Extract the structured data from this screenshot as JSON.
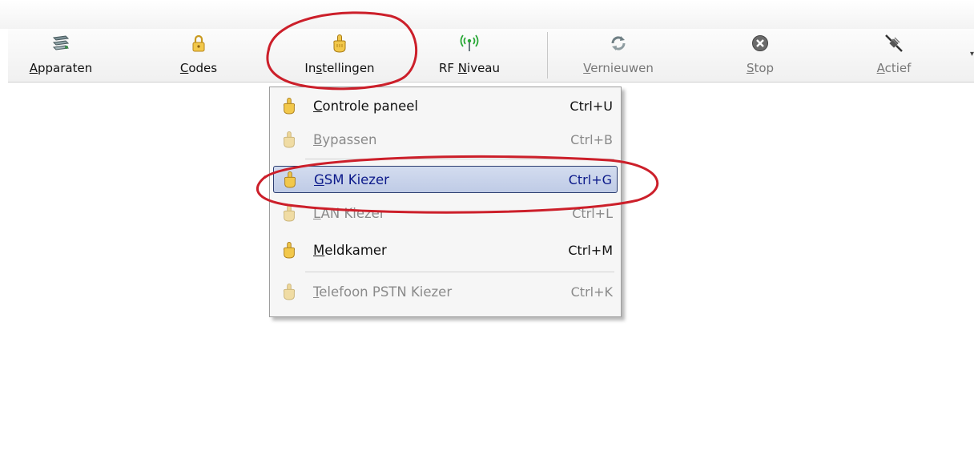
{
  "toolbar": {
    "buttons": [
      {
        "pre": "",
        "mnemonic": "A",
        "post": "pparaten",
        "icon": "devices-icon",
        "disabled": false
      },
      {
        "pre": "",
        "mnemonic": "C",
        "post": "odes",
        "icon": "padlock-icon",
        "disabled": false
      },
      {
        "pre": "In",
        "mnemonic": "s",
        "post": "tellingen",
        "icon": "settings-hand-icon",
        "disabled": false
      },
      {
        "pre": "RF ",
        "mnemonic": "N",
        "post": "iveau",
        "icon": "rf-antenna-icon",
        "disabled": false
      },
      {
        "pre": "",
        "mnemonic": "V",
        "post": "ernieuwen",
        "icon": "refresh-icon",
        "disabled": true
      },
      {
        "pre": "",
        "mnemonic": "S",
        "post": "top",
        "icon": "stop-icon",
        "disabled": true
      },
      {
        "pre": "",
        "mnemonic": "A",
        "post": "ctief",
        "icon": "plug-icon",
        "disabled": true
      }
    ],
    "overflow_glyph": "▾"
  },
  "menu": {
    "items": [
      {
        "mnemonic": "C",
        "rest": "ontrole paneel",
        "shortcut": "Ctrl+U",
        "disabled": false,
        "highlight": false
      },
      {
        "mnemonic": "B",
        "rest": "ypassen",
        "shortcut": "Ctrl+B",
        "disabled": true,
        "highlight": false
      },
      {
        "mnemonic": "G",
        "rest": "SM Kiezer",
        "shortcut": "Ctrl+G",
        "disabled": false,
        "highlight": true
      },
      {
        "mnemonic": "L",
        "rest": "AN Kiezer",
        "shortcut": "Ctrl+L",
        "disabled": true,
        "highlight": false
      },
      {
        "mnemonic": "M",
        "rest": "eldkamer",
        "shortcut": "Ctrl+M",
        "disabled": false,
        "highlight": false
      },
      {
        "mnemonic": "T",
        "rest": "elefoon PSTN Kiezer",
        "shortcut": "Ctrl+K",
        "disabled": true,
        "highlight": false
      }
    ]
  },
  "colors": {
    "highlight_border": "#2c3d71",
    "highlight_text": "#0c1a8a",
    "annotation": "#cc1f2a",
    "icon_gold": "#e2b23a"
  }
}
